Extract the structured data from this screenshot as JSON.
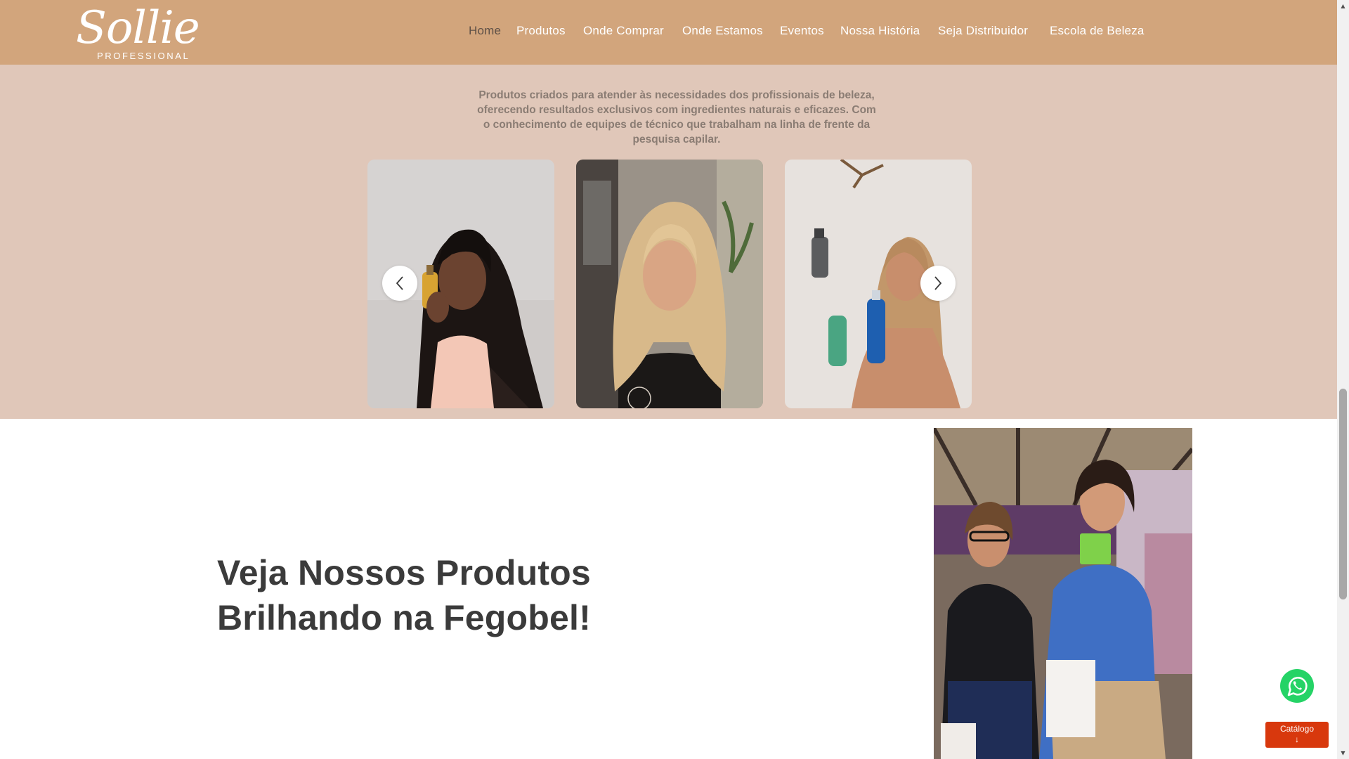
{
  "brand": {
    "logo_script": "Sollie",
    "logo_sub": "PROFESSIONAL",
    "header_color": "#d2a57c"
  },
  "nav": {
    "items": [
      {
        "label": "Home",
        "active": true
      },
      {
        "label": "Produtos"
      },
      {
        "label": "Onde Comprar"
      },
      {
        "label": "Onde Estamos"
      },
      {
        "label": "Eventos"
      },
      {
        "label": "Nossa História"
      },
      {
        "label": "Seja Distribuidor"
      },
      {
        "label": "Escola de Beleza"
      }
    ]
  },
  "hero": {
    "background": "#e0c7b9",
    "description_lines": [
      "Produtos criados para atender às necessidades dos profissionais de beleza,",
      "oferecendo resultados exclusivos com ingredientes naturais e eficazes. Com",
      "o conhecimento de equipes de técnico  que trabalham na linha de frente da",
      "pesquisa capilar."
    ],
    "slides": [
      {
        "icon": "woman-with-oil-bottle-photo"
      },
      {
        "icon": "blonde-woman-salon-photo"
      },
      {
        "icon": "woman-with-products-photo"
      }
    ],
    "prev_icon": "chevron-left-icon",
    "next_icon": "chevron-right-icon"
  },
  "section": {
    "title_lines": [
      "Veja Nossos Produtos",
      "Brilhando na Fegobel!"
    ],
    "photo_icon": "fegobel-event-photo"
  },
  "floating": {
    "whatsapp_icon": "whatsapp-icon",
    "catalog_label": "Catálogo",
    "catalog_arrow": "↓",
    "catalog_color": "#d8380d"
  }
}
